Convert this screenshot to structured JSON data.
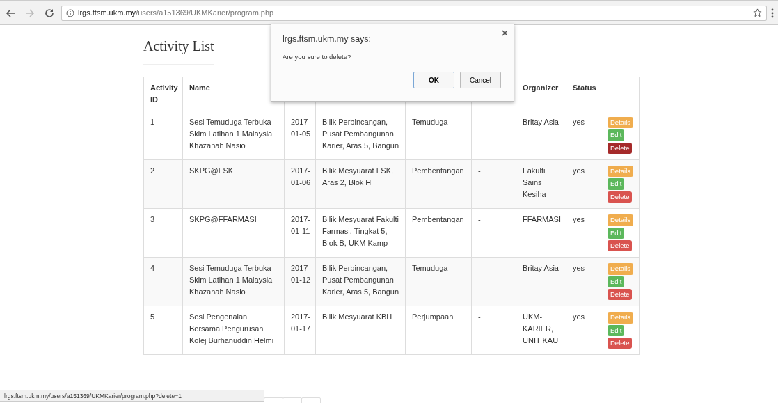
{
  "browser": {
    "url_host": "lrgs.ftsm.ukm.my",
    "url_path": "/users/a151369/UKMKarier/program.php"
  },
  "page": {
    "title": "Activity List"
  },
  "table": {
    "columns": [
      {
        "label": "Activity ID"
      },
      {
        "label": "Name"
      },
      {},
      {},
      {},
      {},
      {
        "label": "Organizer"
      },
      {
        "label": "Status"
      },
      {}
    ],
    "rows": [
      {
        "cells": [
          "1",
          "Sesi Temuduga Terbuka Skim Latihan 1 Malaysia Khazanah Nasio",
          "2017-01-05",
          "Bilik Perbincangan, Pusat Pembangunan Karier, Aras 5, Bangun",
          "Temuduga",
          "-",
          "Britay Asia",
          "yes"
        ],
        "actions": [
          {
            "kind": "details",
            "label": "Details",
            "hovered": false
          },
          {
            "kind": "edit",
            "label": "Edit",
            "hovered": false
          },
          {
            "kind": "delete",
            "label": "Delete",
            "hovered": true
          }
        ]
      },
      {
        "cells": [
          "2",
          "SKPG@FSK",
          "2017-01-06",
          "Bilik Mesyuarat FSK, Aras 2, Blok H",
          "Pembentangan",
          "-",
          "Fakulti Sains Kesiha",
          "yes"
        ],
        "actions": [
          {
            "kind": "details",
            "label": "Details",
            "hovered": false
          },
          {
            "kind": "edit",
            "label": "Edit",
            "hovered": false
          },
          {
            "kind": "delete",
            "label": "Delete",
            "hovered": false
          }
        ]
      },
      {
        "cells": [
          "3",
          "SKPG@FFARMASI",
          "2017-01-11",
          "Bilik Mesyuarat Fakulti Farmasi, Tingkat 5, Blok B, UKM Kamp",
          "Pembentangan",
          "-",
          "FFARMASI",
          "yes"
        ],
        "actions": [
          {
            "kind": "details",
            "label": "Details",
            "hovered": false
          },
          {
            "kind": "edit",
            "label": "Edit",
            "hovered": false
          },
          {
            "kind": "delete",
            "label": "Delete",
            "hovered": false
          }
        ]
      },
      {
        "cells": [
          "4",
          "Sesi Temuduga Terbuka Skim Latihan 1 Malaysia Khazanah Nasio",
          "2017-01-12",
          "Bilik Perbincangan, Pusat Pembangunan Karier, Aras 5, Bangun",
          "Temuduga",
          "-",
          "Britay Asia",
          "yes"
        ],
        "actions": [
          {
            "kind": "details",
            "label": "Details",
            "hovered": false
          },
          {
            "kind": "edit",
            "label": "Edit",
            "hovered": false
          },
          {
            "kind": "delete",
            "label": "Delete",
            "hovered": false
          }
        ]
      },
      {
        "cells": [
          "5",
          "Sesi Pengenalan Bersama Pengurusan Kolej Burhanuddin Helmi",
          "2017-01-17",
          "Bilik Mesyuarat KBH",
          "Perjumpaan",
          "-",
          "UKM-KARIER, UNIT KAU",
          "yes"
        ],
        "actions": [
          {
            "kind": "details",
            "label": "Details",
            "hovered": false
          },
          {
            "kind": "edit",
            "label": "Edit",
            "hovered": false
          },
          {
            "kind": "delete",
            "label": "Delete",
            "hovered": false
          }
        ]
      }
    ]
  },
  "dialog": {
    "title": "lrgs.ftsm.ukm.my says:",
    "message": "Are you sure to delete?",
    "buttons": [
      {
        "label": "OK",
        "kind": "primary"
      },
      {
        "label": "Cancel",
        "kind": "secondary"
      }
    ]
  },
  "status_bar": {
    "text": "lrgs.ftsm.ukm.my/users/a151369/UKMKarier/program.php?delete=1"
  }
}
